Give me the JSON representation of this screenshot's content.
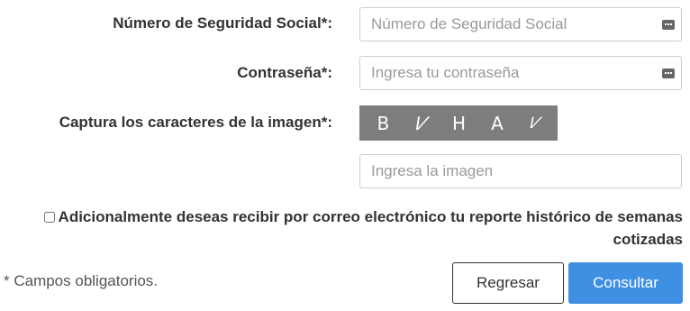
{
  "form": {
    "nss": {
      "label": "Número de Seguridad Social*:",
      "placeholder": "Número de Seguridad Social",
      "icon": "keyboard-icon"
    },
    "password": {
      "label": "Contraseña*:",
      "placeholder": "Ingresa tu contraseña",
      "icon": "keyboard-icon"
    },
    "captcha": {
      "label": "Captura los caracteres de la imagen*:",
      "chars": [
        "B",
        "V",
        "H",
        "A",
        "V"
      ],
      "placeholder": "Ingresa la imagen"
    },
    "email_report": {
      "label": "Adicionalmente deseas recibir por correo electrónico tu reporte histórico de semanas cotizadas",
      "checked": false
    },
    "required_note": "* Campos obligatorios.",
    "back_label": "Regresar",
    "submit_label": "Consultar"
  },
  "colors": {
    "primary": "#3f8fe3",
    "captcha_bg": "#7d7d7d"
  }
}
